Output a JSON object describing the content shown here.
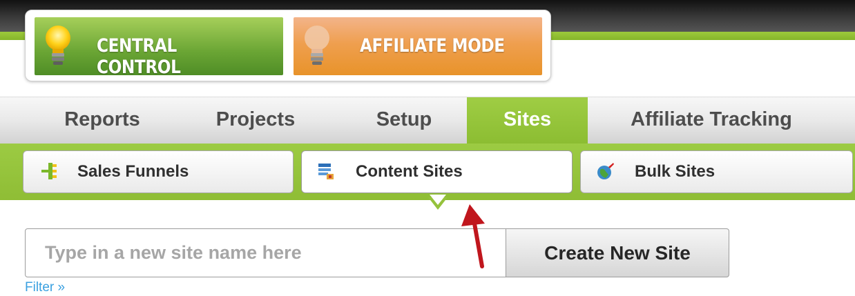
{
  "modes": {
    "central_control": "CENTRAL CONTROL",
    "affiliate_mode": "AFFILIATE MODE"
  },
  "nav": {
    "tabs": [
      {
        "label": "Reports"
      },
      {
        "label": "Projects"
      },
      {
        "label": "Setup"
      },
      {
        "label": "Sites",
        "active": true
      },
      {
        "label": "Affiliate Tracking"
      }
    ]
  },
  "subnav": {
    "items": [
      {
        "label": "Sales Funnels",
        "icon": "sales-funnel-icon"
      },
      {
        "label": "Content Sites",
        "icon": "content-sites-icon",
        "active": true
      },
      {
        "label": "Bulk Sites",
        "icon": "bulk-sites-globe-icon"
      }
    ]
  },
  "form": {
    "placeholder": "Type in a new site name here",
    "value": "",
    "create_label": "Create New Site",
    "filter_label": "Filter »"
  },
  "colors": {
    "accent_green": "#95c23c",
    "affiliate_orange": "#ee9e46",
    "link_blue": "#3aa0e0",
    "annotation_red": "#c0161d"
  }
}
